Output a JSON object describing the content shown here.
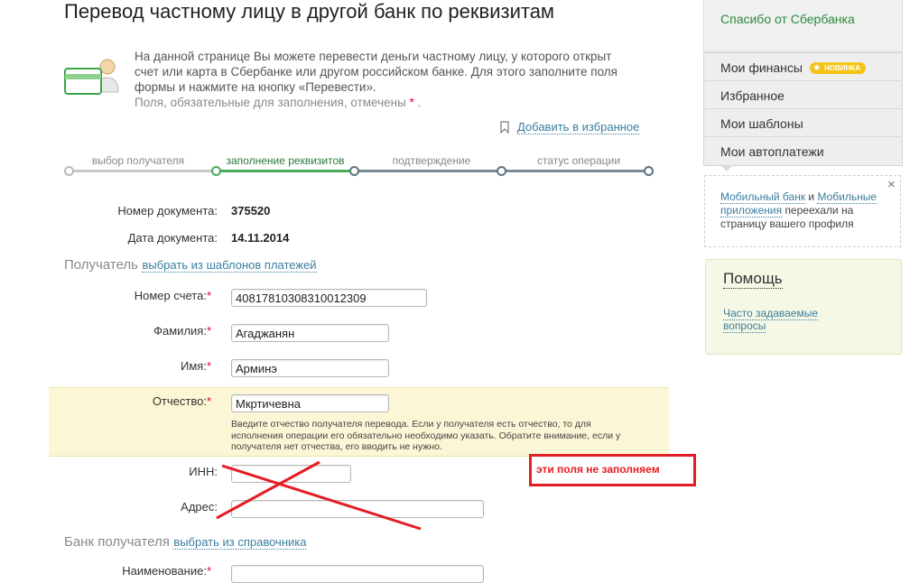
{
  "page": {
    "title": "Перевод частному лицу в другой банк по реквизитам",
    "intro_line1": "На данной странице Вы можете перевести деньги частному лицу, у которого открыт",
    "intro_line2": "счет или карта в Сбербанке или другом российском банке. Для этого заполните поля",
    "intro_line3": "формы и нажмите на кнопку «Перевести».",
    "required_note": "Поля, обязательные для заполнения, отмечены",
    "required_star": "*",
    "required_dot": ".",
    "add_favorite": "Добавить в избранное"
  },
  "steps": [
    {
      "label": "выбор получателя",
      "state": "done"
    },
    {
      "label": "заполнение реквизитов",
      "state": "active"
    },
    {
      "label": "подтверждение",
      "state": "pending"
    },
    {
      "label": "статус операции",
      "state": "pending"
    }
  ],
  "document": {
    "number_label": "Номер документа:",
    "number_value": "375520",
    "date_label": "Дата документа:",
    "date_value": "14.11.2014"
  },
  "recipient": {
    "section_title": "Получатель",
    "section_link": "выбрать из шаблонов платежей",
    "account_label": "Номер счета:",
    "account_value": "40817810308310012309",
    "surname_label": "Фамилия:",
    "surname_value": "Агаджанян",
    "name_label": "Имя:",
    "name_value": "Арминэ",
    "patronymic_label": "Отчество:",
    "patronymic_value": "Мкртичевна",
    "patronymic_hint_line1": "Введите отчество получателя перевода. Если у получателя есть отчество, то для",
    "patronymic_hint_line2": "исполнения операции его обязательно необходимо указать. Обратите внимание, если у",
    "patronymic_hint_line3": "получателя нет отчества, его вводить не нужно.",
    "inn_label": "ИНН:",
    "inn_value": "",
    "address_label": "Адрес:",
    "address_value": "",
    "star": "*"
  },
  "bank": {
    "section_title": "Банк получателя",
    "section_link": "выбрать из справочника",
    "name_label": "Наименование:"
  },
  "annotation": {
    "text": "эти поля не заполняем",
    "color": "#e41d24"
  },
  "sidebar": {
    "thanks": "Спасибо от Сбербанка",
    "menu": [
      {
        "label": "Мои финансы",
        "badge": "НОВИНКА"
      },
      {
        "label": "Избранное"
      },
      {
        "label": "Мои шаблоны"
      },
      {
        "label": "Мои автоплатежи"
      }
    ],
    "notice_link1": "Мобильный банк",
    "notice_and": "и",
    "notice_link2": "Мобильные приложения",
    "notice_rest": "переехали на страницу вашего профиля",
    "close": "×",
    "help_title": "Помощь",
    "help_link": "Часто задаваемые вопросы"
  },
  "colors": {
    "brand_green": "#2a8a3a",
    "link_blue": "#3b7ea1",
    "hint_bg": "#fbf6d5",
    "badge_yellow": "#f5c419"
  }
}
